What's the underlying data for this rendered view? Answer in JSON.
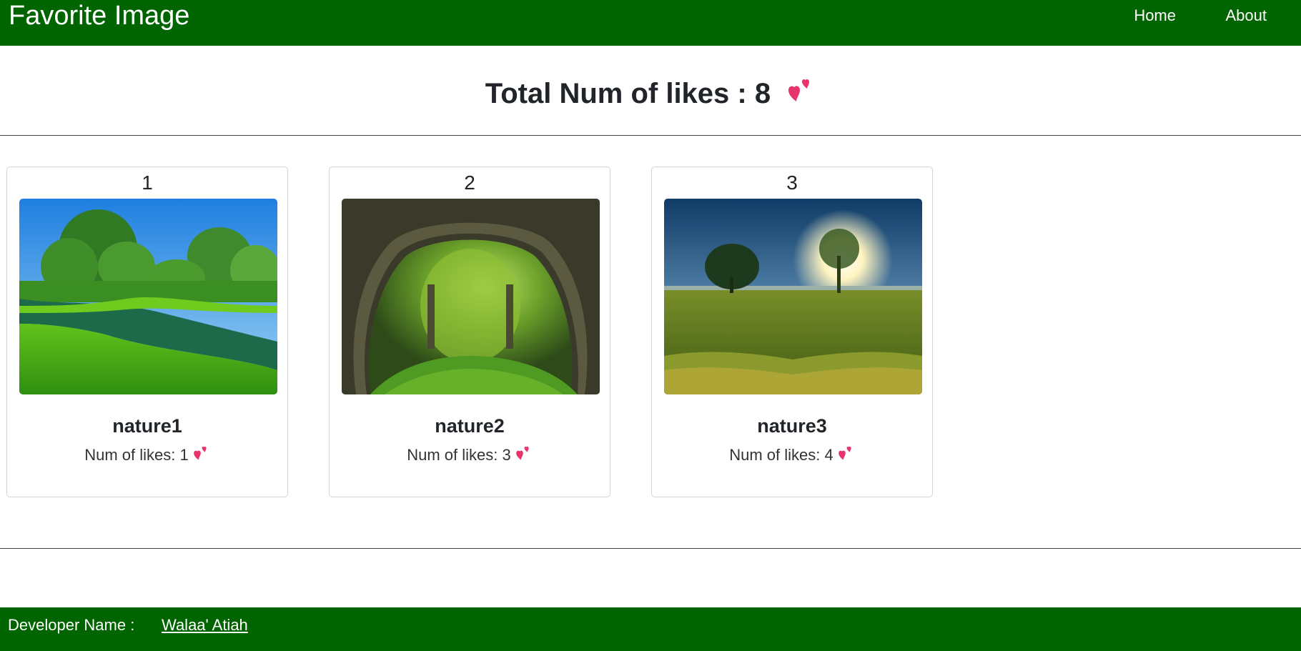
{
  "navbar": {
    "brand": "Favorite Image",
    "links": [
      {
        "label": "Home"
      },
      {
        "label": "About"
      }
    ],
    "bg_color": "#006400"
  },
  "summary": {
    "label": "Total Num of likes : 8",
    "icon": "two-hearts-icon"
  },
  "cards": [
    {
      "number": "1",
      "title": "nature1",
      "likes_label": "Num of likes: 1",
      "image": "river-meadow-trees"
    },
    {
      "number": "2",
      "title": "nature2",
      "likes_label": "Num of likes: 3",
      "image": "forest-tree-tunnel"
    },
    {
      "number": "3",
      "title": "nature3",
      "likes_label": "Num of likes: 4",
      "image": "sunset-field-trees"
    }
  ],
  "footer": {
    "label": "Developer Name :",
    "developer": "Walaa' Atiah",
    "bg_color": "#006400"
  },
  "colors": {
    "heart": "#e8336d",
    "text": "#212529"
  }
}
